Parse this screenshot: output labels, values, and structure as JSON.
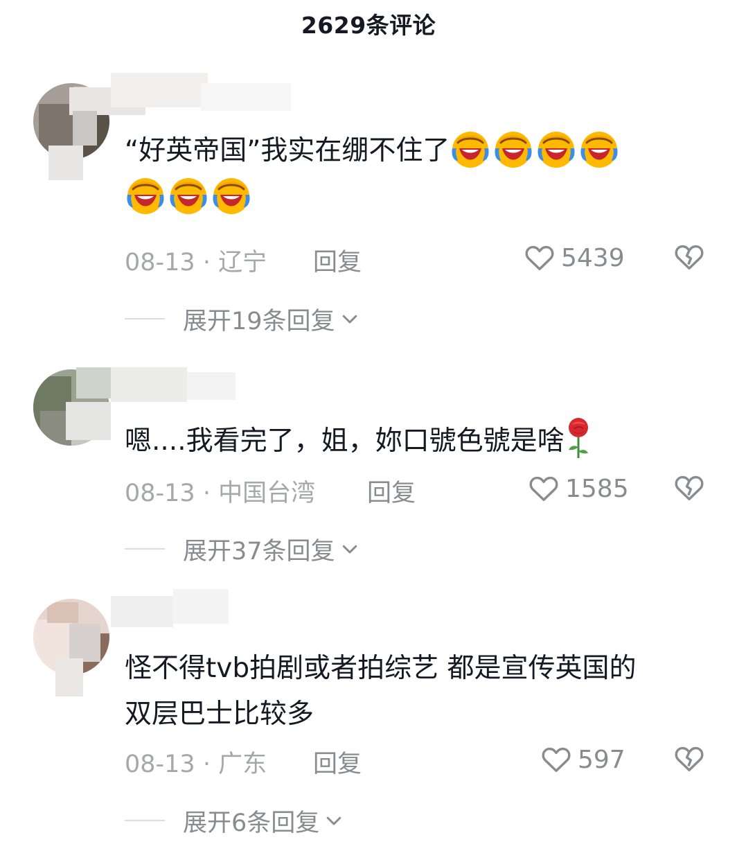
{
  "header": {
    "title": "2629条评论"
  },
  "comments": [
    {
      "text_line1": "“好英帝国”我实在绷不住了",
      "date_location": "08-13 · 辽宁",
      "reply_label": "回复",
      "likes": "5439",
      "expand_label": "展开19条回复",
      "emoji_after_text": "laughing-crying-emoji",
      "emoji_count": 7
    },
    {
      "text_line1": "嗯....我看完了，姐，妳口號色號是啥",
      "date_location": "08-13 · 中国台湾",
      "reply_label": "回复",
      "likes": "1585",
      "expand_label": "展开37条回复",
      "emoji_after_text": "rose-emoji"
    },
    {
      "text_line1": "怪不得tvb拍剧或者拍综艺 都是宣传英国的",
      "text_line2": "双层巴士比较多",
      "date_location": "08-13 · 广东",
      "reply_label": "回复",
      "likes": "597",
      "expand_label": "展开6条回复"
    }
  ],
  "icons": {
    "like": "heart-outline-icon",
    "dislike": "broken-heart-icon",
    "expand": "chevron-down-icon"
  },
  "colors": {
    "primary_text": "#161823",
    "secondary_text": "#8a8b91",
    "emoji_face": "#ffb900",
    "emoji_tear": "#3a8ee6"
  }
}
